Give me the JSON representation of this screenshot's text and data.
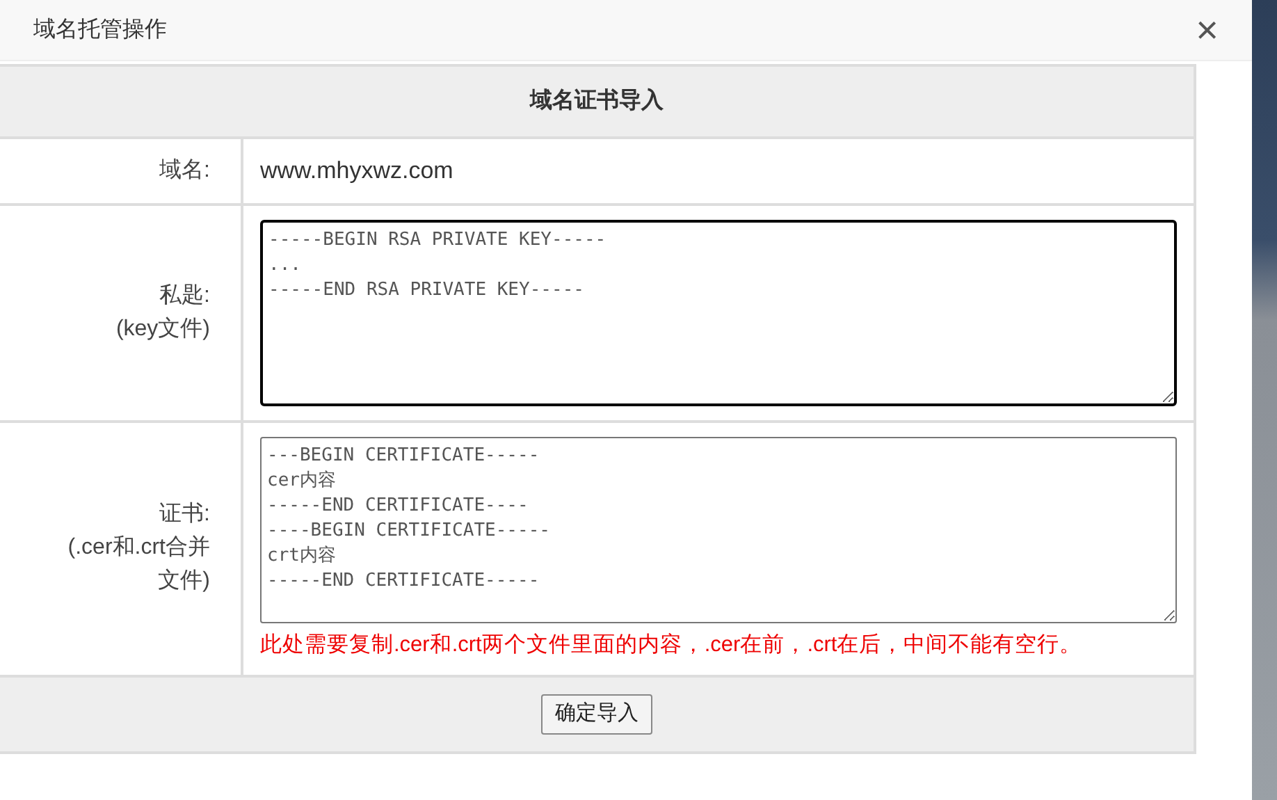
{
  "dialog": {
    "title": "域名托管操作",
    "close": "×"
  },
  "form": {
    "heading": "域名证书导入",
    "rows": [
      {
        "kind": "text",
        "label": "域名:",
        "value": "www.mhyxwz.com"
      },
      {
        "kind": "textarea",
        "label": "私匙:\n(key文件)",
        "value": "-----BEGIN RSA PRIVATE KEY-----\n...\n-----END RSA PRIVATE KEY-----",
        "focused": true
      },
      {
        "kind": "textarea",
        "label": "证书:\n(.cer和.crt合并文件)",
        "value": "---BEGIN CERTIFICATE-----\ncer内容\n-----END CERTIFICATE----\n----BEGIN CERTIFICATE-----\ncrt内容\n-----END CERTIFICATE-----",
        "focused": false,
        "note": "此处需要复制.cer和.crt两个文件里面的内容，.cer在前，.crt在后，中间不能有空行。"
      }
    ],
    "submit": "确定导入"
  }
}
